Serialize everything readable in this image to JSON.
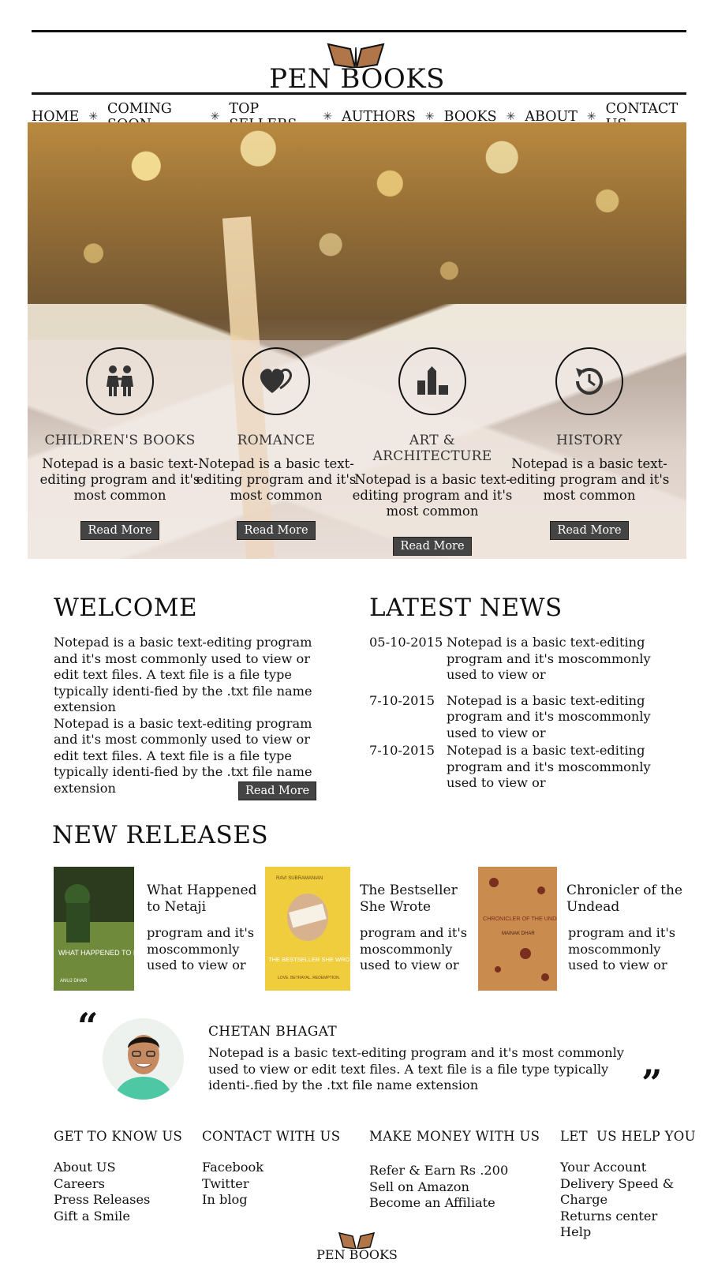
{
  "brand": {
    "name": "PEN BOOKS",
    "logo_icon": "open-book-icon",
    "accent": "#b07548"
  },
  "nav": {
    "items": [
      {
        "label": "HOME"
      },
      {
        "label": "COMING SOON"
      },
      {
        "label": "TOP SELLERS"
      },
      {
        "label": "AUTHORS"
      },
      {
        "label": "BOOKS"
      },
      {
        "label": "ABOUT"
      },
      {
        "label": "CONTACT US"
      }
    ],
    "separator": "✳"
  },
  "categories": [
    {
      "title": "CHILDREN'S BOOKS",
      "desc": "Notepad is a basic text-editing program and it's most common",
      "button": "Read More",
      "icon": "children-icon"
    },
    {
      "title": "ROMANCE",
      "desc": "Notepad is a basic text-editing program and it's most common",
      "button": "Read More",
      "icon": "heart-icon"
    },
    {
      "title": "ART & ARCHITECTURE",
      "desc": "Notepad is a basic text-editing program and it's most common",
      "button": "Read More",
      "icon": "building-icon"
    },
    {
      "title": "HISTORY",
      "desc": "Notepad is a basic text-editing program and it's most common",
      "button": "Read More",
      "icon": "history-icon"
    }
  ],
  "welcome": {
    "title": "WELCOME",
    "para1": "Notepad is a basic text-editing program and it's most commonly used to view or edit text files. A text file is a file type typically identi-fied by the .txt file name extension",
    "para2": "Notepad is a basic text-editing program and it's most commonly used to view or edit text files. A text file is a file type typically identi-fied by the .txt file name extension",
    "button": "Read More"
  },
  "news": {
    "title": "LATEST NEWS",
    "items": [
      {
        "date": "05-10-2015",
        "text": "Notepad is a basic text-editing program and it's moscommonly used to view or"
      },
      {
        "date": "7-10-2015",
        "text": "Notepad is a basic text-editing program and it's moscommonly used to view or"
      },
      {
        "date": "7-10-2015",
        "text": "Notepad is a basic text-editing program and it's moscommonly used to view or"
      }
    ]
  },
  "releases": {
    "title": "NEW RELEASES",
    "books": [
      {
        "title": "What Happened to Netaji",
        "desc": "program and it's moscommonly used to view or",
        "cover_text": "WHAT HAPPENED TO NETAJI?",
        "cover_author": "ANUJ DHAR",
        "cover_top": ""
      },
      {
        "title": "The Bestseller She Wrote",
        "desc": "program and it's moscommonly used to view or",
        "cover_text": "THE BESTSELLER SHE WROTE",
        "cover_author": "RAVI SUBRAMANIAN",
        "cover_top": "LOVE. BETRAYAL. REDEMPTION."
      },
      {
        "title": "Chronicler of the Undead",
        "desc": "program and it's moscommonly used to view or",
        "cover_text": "CHRONICLER OF THE UNDEAD",
        "cover_author": "MAINAK DHAR",
        "cover_top": ""
      }
    ]
  },
  "testimonial": {
    "name": "CHETAN BHAGAT",
    "text": "Notepad is a basic text-editing program and it's most commonly used to view or edit text files. A text file is a file type typically identi-.fied by the .txt file name extension",
    "open_quote": "“",
    "close_quote": "”"
  },
  "footer": {
    "columns": [
      {
        "title": "GET TO KNOW US",
        "links": [
          "About US",
          "Careers",
          "Press Releases",
          "Gift a Smile"
        ]
      },
      {
        "title": "CONTACT WITH US",
        "links": [
          "Facebook",
          "Twitter",
          "In blog"
        ]
      },
      {
        "title": "MAKE MONEY WITH US",
        "links": [
          "Refer & Earn Rs .200",
          "Sell on Amazon",
          "Become an Affiliate"
        ]
      },
      {
        "title": "LET  US HELP YOU",
        "links": [
          "Your Account",
          "Delivery Speed &",
          "Charge",
          "Returns center",
          "Help"
        ]
      }
    ],
    "brand": "PEN BOOKS"
  }
}
